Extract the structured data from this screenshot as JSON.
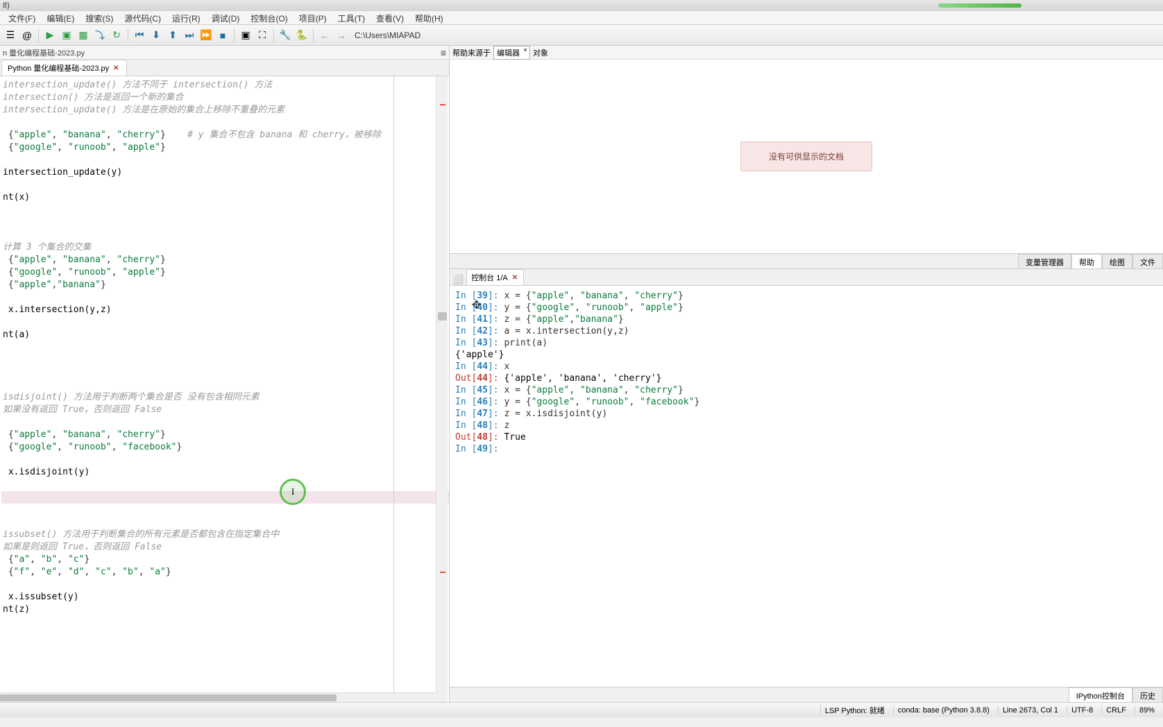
{
  "title_suffix": "8)",
  "menu": [
    "文件(F)",
    "编辑(E)",
    "搜索(S)",
    "源代码(C)",
    "运行(R)",
    "调试(D)",
    "控制台(O)",
    "项目(P)",
    "工具(T)",
    "查看(V)",
    "帮助(H)"
  ],
  "path": "C:\\Users\\MIAPAD",
  "breadcrumb": "n 量化编程基础-2023.py",
  "tab_name": "Python 量化编程基础-2023.py",
  "editor": [
    {
      "t": "comment",
      "txt": "intersection_update() 方法不同于 intersection() 方法"
    },
    {
      "t": "comment",
      "txt": "intersection() 方法是返回一个新的集合"
    },
    {
      "t": "comment",
      "txt": "intersection_update() 方法是在原始的集合上移除不重叠的元素"
    },
    {
      "t": "blank",
      "txt": ""
    },
    {
      "t": "code",
      "seg": [
        {
          "c": "plain",
          "v": " {"
        },
        {
          "c": "string",
          "v": "\"apple\""
        },
        {
          "c": "plain",
          "v": ", "
        },
        {
          "c": "string",
          "v": "\"banana\""
        },
        {
          "c": "plain",
          "v": ", "
        },
        {
          "c": "string",
          "v": "\"cherry\""
        },
        {
          "c": "plain",
          "v": "}    "
        },
        {
          "c": "comment",
          "v": "# y 集合不包含 banana 和 cherry，被移除"
        }
      ]
    },
    {
      "t": "code",
      "seg": [
        {
          "c": "plain",
          "v": " {"
        },
        {
          "c": "string",
          "v": "\"google\""
        },
        {
          "c": "plain",
          "v": ", "
        },
        {
          "c": "string",
          "v": "\"runoob\""
        },
        {
          "c": "plain",
          "v": ", "
        },
        {
          "c": "string",
          "v": "\"apple\""
        },
        {
          "c": "plain",
          "v": "}"
        }
      ]
    },
    {
      "t": "blank",
      "txt": ""
    },
    {
      "t": "plain",
      "txt": "intersection_update(y)"
    },
    {
      "t": "blank",
      "txt": ""
    },
    {
      "t": "plain",
      "txt": "nt(x)"
    },
    {
      "t": "blank",
      "txt": ""
    },
    {
      "t": "blank",
      "txt": ""
    },
    {
      "t": "blank",
      "txt": ""
    },
    {
      "t": "comment",
      "txt": "计算 3 个集合的交集"
    },
    {
      "t": "code",
      "seg": [
        {
          "c": "plain",
          "v": " {"
        },
        {
          "c": "string",
          "v": "\"apple\""
        },
        {
          "c": "plain",
          "v": ", "
        },
        {
          "c": "string",
          "v": "\"banana\""
        },
        {
          "c": "plain",
          "v": ", "
        },
        {
          "c": "string",
          "v": "\"cherry\""
        },
        {
          "c": "plain",
          "v": "}"
        }
      ]
    },
    {
      "t": "code",
      "seg": [
        {
          "c": "plain",
          "v": " {"
        },
        {
          "c": "string",
          "v": "\"google\""
        },
        {
          "c": "plain",
          "v": ", "
        },
        {
          "c": "string",
          "v": "\"runoob\""
        },
        {
          "c": "plain",
          "v": ", "
        },
        {
          "c": "string",
          "v": "\"apple\""
        },
        {
          "c": "plain",
          "v": "}"
        }
      ]
    },
    {
      "t": "code",
      "seg": [
        {
          "c": "plain",
          "v": " {"
        },
        {
          "c": "string",
          "v": "\"apple\""
        },
        {
          "c": "plain",
          "v": ","
        },
        {
          "c": "string",
          "v": "\"banana\""
        },
        {
          "c": "plain",
          "v": "}"
        }
      ]
    },
    {
      "t": "blank",
      "txt": ""
    },
    {
      "t": "plain",
      "txt": " x.intersection(y,z)"
    },
    {
      "t": "blank",
      "txt": ""
    },
    {
      "t": "plain",
      "txt": "nt(a)"
    },
    {
      "t": "blank",
      "txt": ""
    },
    {
      "t": "blank",
      "txt": ""
    },
    {
      "t": "blank",
      "txt": ""
    },
    {
      "t": "blank",
      "txt": ""
    },
    {
      "t": "comment",
      "txt": "isdisjoint() 方法用于判断两个集合是否 没有包含相同元素"
    },
    {
      "t": "comment",
      "txt": "如果没有返回 True，否则返回 False"
    },
    {
      "t": "blank",
      "txt": ""
    },
    {
      "t": "code",
      "seg": [
        {
          "c": "plain",
          "v": " {"
        },
        {
          "c": "string",
          "v": "\"apple\""
        },
        {
          "c": "plain",
          "v": ", "
        },
        {
          "c": "string",
          "v": "\"banana\""
        },
        {
          "c": "plain",
          "v": ", "
        },
        {
          "c": "string",
          "v": "\"cherry\""
        },
        {
          "c": "plain",
          "v": "}"
        }
      ]
    },
    {
      "t": "code",
      "seg": [
        {
          "c": "plain",
          "v": " {"
        },
        {
          "c": "string",
          "v": "\"google\""
        },
        {
          "c": "plain",
          "v": ", "
        },
        {
          "c": "string",
          "v": "\"runoob\""
        },
        {
          "c": "plain",
          "v": ", "
        },
        {
          "c": "string",
          "v": "\"facebook\""
        },
        {
          "c": "plain",
          "v": "}"
        }
      ]
    },
    {
      "t": "blank",
      "txt": ""
    },
    {
      "t": "plain",
      "txt": " x.isdisjoint(y)"
    },
    {
      "t": "blank",
      "txt": ""
    },
    {
      "t": "highlight",
      "txt": ""
    },
    {
      "t": "blank",
      "txt": ""
    },
    {
      "t": "blank",
      "txt": ""
    },
    {
      "t": "comment",
      "txt": "issubset() 方法用于判断集合的所有元素是否都包含在指定集合中"
    },
    {
      "t": "comment",
      "txt": "如果是则返回 True，否则返回 False"
    },
    {
      "t": "code",
      "seg": [
        {
          "c": "plain",
          "v": " {"
        },
        {
          "c": "string",
          "v": "\"a\""
        },
        {
          "c": "plain",
          "v": ", "
        },
        {
          "c": "string",
          "v": "\"b\""
        },
        {
          "c": "plain",
          "v": ", "
        },
        {
          "c": "string",
          "v": "\"c\""
        },
        {
          "c": "plain",
          "v": "}"
        }
      ]
    },
    {
      "t": "code",
      "seg": [
        {
          "c": "plain",
          "v": " {"
        },
        {
          "c": "string",
          "v": "\"f\""
        },
        {
          "c": "plain",
          "v": ", "
        },
        {
          "c": "string",
          "v": "\"e\""
        },
        {
          "c": "plain",
          "v": ", "
        },
        {
          "c": "string",
          "v": "\"d\""
        },
        {
          "c": "plain",
          "v": ", "
        },
        {
          "c": "string",
          "v": "\"c\""
        },
        {
          "c": "plain",
          "v": ", "
        },
        {
          "c": "string",
          "v": "\"b\""
        },
        {
          "c": "plain",
          "v": ", "
        },
        {
          "c": "string",
          "v": "\"a\""
        },
        {
          "c": "plain",
          "v": "}"
        }
      ]
    },
    {
      "t": "blank",
      "txt": ""
    },
    {
      "t": "plain",
      "txt": " x.issubset(y)"
    },
    {
      "t": "plain",
      "txt": "nt(z)"
    }
  ],
  "help_source_label": "帮助来源于",
  "help_source_value": "编辑器",
  "help_source_after": "▾",
  "object_label": "对象",
  "no_doc": "没有可供显示的文档",
  "right_tabs_top": [
    "变量管理器",
    "帮助",
    "绘图",
    "文件"
  ],
  "console_tab": "控制台 1/A",
  "bottom_tabs": [
    "IPython控制台",
    "历史"
  ],
  "console_lines": [
    {
      "type": "in",
      "n": "39",
      "hidden": true,
      "seg": [
        {
          "c": "plain",
          "v": "x = {"
        },
        {
          "c": "string",
          "v": "\"apple\""
        },
        {
          "c": "plain",
          "v": ", "
        },
        {
          "c": "string",
          "v": "\"banana\""
        },
        {
          "c": "plain",
          "v": ", "
        },
        {
          "c": "string",
          "v": "\"cherry\""
        },
        {
          "c": "plain",
          "v": "}"
        }
      ]
    },
    {
      "type": "blank"
    },
    {
      "type": "in",
      "n": "40",
      "seg": [
        {
          "c": "plain",
          "v": "y = {"
        },
        {
          "c": "string",
          "v": "\"google\""
        },
        {
          "c": "plain",
          "v": ", "
        },
        {
          "c": "string",
          "v": "\"runoob\""
        },
        {
          "c": "plain",
          "v": ", "
        },
        {
          "c": "string",
          "v": "\"apple\""
        },
        {
          "c": "plain",
          "v": "}"
        }
      ]
    },
    {
      "type": "blank"
    },
    {
      "type": "in",
      "n": "41",
      "seg": [
        {
          "c": "plain",
          "v": "z = {"
        },
        {
          "c": "string",
          "v": "\"apple\""
        },
        {
          "c": "plain",
          "v": ","
        },
        {
          "c": "string",
          "v": "\"banana\""
        },
        {
          "c": "plain",
          "v": "}"
        }
      ]
    },
    {
      "type": "blank"
    },
    {
      "type": "in",
      "n": "42",
      "seg": [
        {
          "c": "plain",
          "v": "a = x.intersection(y,z)"
        }
      ]
    },
    {
      "type": "blank"
    },
    {
      "type": "in",
      "n": "43",
      "seg": [
        {
          "c": "func",
          "v": "print"
        },
        {
          "c": "plain",
          "v": "(a)"
        }
      ]
    },
    {
      "type": "txt",
      "v": "{'apple'}"
    },
    {
      "type": "blank"
    },
    {
      "type": "in",
      "n": "44",
      "seg": [
        {
          "c": "plain",
          "v": "x"
        }
      ]
    },
    {
      "type": "out",
      "n": "44",
      "v": "{'apple', 'banana', 'cherry'}"
    },
    {
      "type": "blank"
    },
    {
      "type": "in",
      "n": "45",
      "seg": [
        {
          "c": "plain",
          "v": "x = {"
        },
        {
          "c": "string",
          "v": "\"apple\""
        },
        {
          "c": "plain",
          "v": ", "
        },
        {
          "c": "string",
          "v": "\"banana\""
        },
        {
          "c": "plain",
          "v": ", "
        },
        {
          "c": "string",
          "v": "\"cherry\""
        },
        {
          "c": "plain",
          "v": "}"
        }
      ]
    },
    {
      "type": "blank"
    },
    {
      "type": "in",
      "n": "46",
      "seg": [
        {
          "c": "plain",
          "v": "y = {"
        },
        {
          "c": "string",
          "v": "\"google\""
        },
        {
          "c": "plain",
          "v": ", "
        },
        {
          "c": "string",
          "v": "\"runoob\""
        },
        {
          "c": "plain",
          "v": ", "
        },
        {
          "c": "string",
          "v": "\"facebook\""
        },
        {
          "c": "plain",
          "v": "}"
        }
      ]
    },
    {
      "type": "blank"
    },
    {
      "type": "in",
      "n": "47",
      "seg": [
        {
          "c": "plain",
          "v": "z = x.isdisjoint(y)"
        }
      ]
    },
    {
      "type": "blank"
    },
    {
      "type": "in",
      "n": "48",
      "seg": [
        {
          "c": "plain",
          "v": "z"
        }
      ]
    },
    {
      "type": "out",
      "n": "48",
      "v": "True"
    },
    {
      "type": "blank"
    },
    {
      "type": "in",
      "n": "49",
      "seg": []
    }
  ],
  "status": {
    "lsp": "LSP Python: 就绪",
    "conda": "conda: base (Python 3.8.8)",
    "linecol": "Line 2673, Col 1",
    "encoding": "UTF-8",
    "eol": "CRLF",
    "mem": "89%"
  }
}
